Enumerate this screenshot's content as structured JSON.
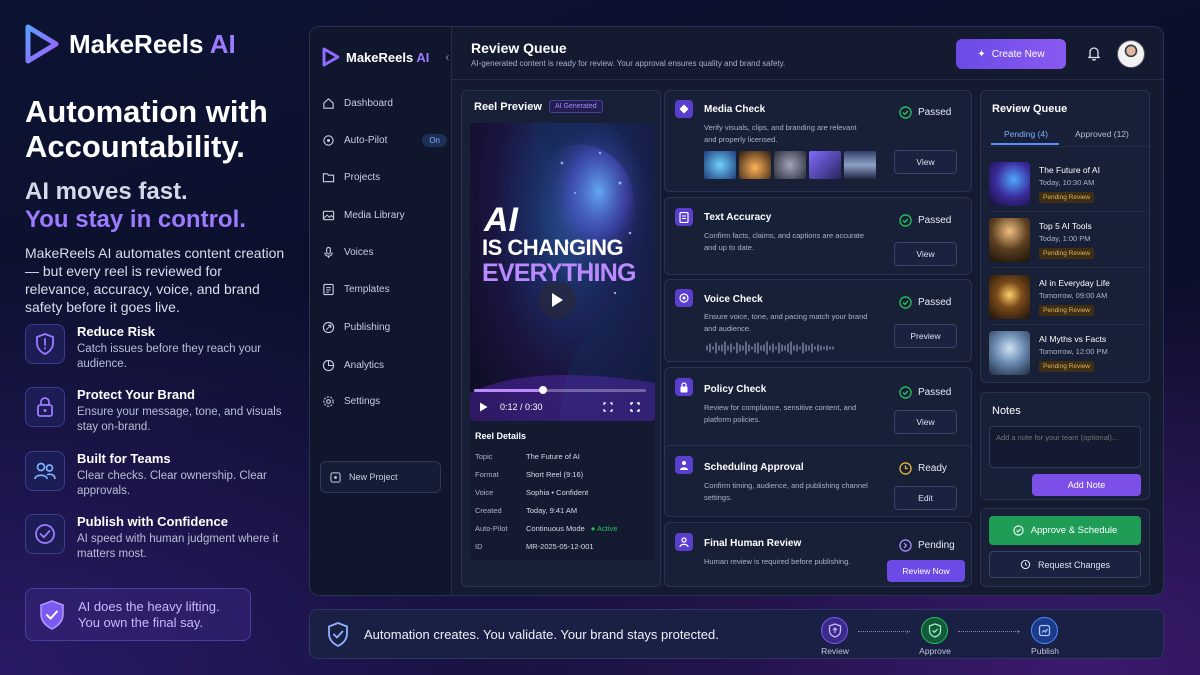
{
  "brand": {
    "name": "MakeReels",
    "suffix": "AI"
  },
  "hero": {
    "headline": "Automation with Accountability.",
    "tagline_1": "AI moves fast.",
    "tagline_2": "You stay in control.",
    "body": "MakeReels AI automates content creation — but every reel is reviewed for relevance, accuracy, voice, and brand safety before it goes live."
  },
  "features": [
    {
      "title": "Reduce Risk",
      "desc": "Catch issues before they reach your audience.",
      "icon": "shield-icon"
    },
    {
      "title": "Protect Your Brand",
      "desc": "Ensure your message, tone, and visuals stay on-brand.",
      "icon": "lock-icon"
    },
    {
      "title": "Built for Teams",
      "desc": "Clear checks. Clear ownership. Clear approvals.",
      "icon": "users-icon"
    },
    {
      "title": "Publish with Confidence",
      "desc": "AI speed with human judgment where it matters most.",
      "icon": "check-circle-icon"
    }
  ],
  "callout": {
    "line1": "AI does the heavy lifting.",
    "line2": "You own the final say."
  },
  "app": {
    "brand": {
      "name": "MakeReels",
      "suffix": "AI"
    },
    "nav": [
      {
        "label": "Dashboard",
        "icon": "home-icon"
      },
      {
        "label": "Auto-Pilot",
        "icon": "autopilot-icon",
        "badge": "On"
      },
      {
        "label": "Projects",
        "icon": "folder-icon"
      },
      {
        "label": "Media Library",
        "icon": "image-icon"
      },
      {
        "label": "Voices",
        "icon": "microphone-icon"
      },
      {
        "label": "Templates",
        "icon": "template-icon"
      },
      {
        "label": "Publishing",
        "icon": "send-icon"
      },
      {
        "label": "Analytics",
        "icon": "chart-icon"
      },
      {
        "label": "Settings",
        "icon": "gear-icon"
      }
    ],
    "new_project": "New Project",
    "header": {
      "title": "Review Queue",
      "subtitle": "AI-generated content is ready for review. Your approval ensures quality and brand safety.",
      "create_label": "Create New"
    },
    "reel": {
      "title": "Reel Preview",
      "tag": "AI Generated",
      "overlay_1": "AI",
      "overlay_2": "IS CHANGING",
      "overlay_3": "EVERYTHING",
      "time": "0:12 / 0:30",
      "progress": 0.4,
      "details_title": "Reel Details",
      "details": [
        {
          "k": "Topic",
          "v": "The Future of AI"
        },
        {
          "k": "Format",
          "v": "Short Reel (9:16)"
        },
        {
          "k": "Voice",
          "v": "Sophia • Confident"
        },
        {
          "k": "Created",
          "v": "Today, 9:41 AM"
        },
        {
          "k": "Auto-Pilot",
          "v": "Continuous Mode",
          "extra": "Active"
        },
        {
          "k": "ID",
          "v": "MR-2025-05-12-001"
        }
      ]
    },
    "checks": [
      {
        "title": "Media Check",
        "desc": "Verify visuals, clips, and branding are relevant and properly licensed.",
        "status": "Passed",
        "action": "View"
      },
      {
        "title": "Text Accuracy",
        "desc": "Confirm facts, claims, and captions are accurate and up to date.",
        "status": "Passed",
        "action": "View"
      },
      {
        "title": "Voice Check",
        "desc": "Ensure voice, tone, and pacing match your brand and audience.",
        "status": "Passed",
        "action": "Preview"
      },
      {
        "title": "Policy Check",
        "desc": "Review for compliance, sensitive content, and platform policies.",
        "status": "Passed",
        "action": "View"
      },
      {
        "title": "Scheduling Approval",
        "desc": "Confirm timing, audience, and publishing channel settings.",
        "status": "Ready",
        "action": "Edit"
      },
      {
        "title": "Final Human Review",
        "desc": "Human review is required before publishing.",
        "status": "Pending",
        "action": "Review Now"
      }
    ],
    "queue": {
      "title": "Review Queue",
      "tab_pending": "Pending (4)",
      "tab_approved": "Approved (12)",
      "items": [
        {
          "title": "The Future of AI",
          "time": "Today, 10:30 AM",
          "badge": "Pending Review"
        },
        {
          "title": "Top 5 AI Tools",
          "time": "Today, 1:00 PM",
          "badge": "Pending Review"
        },
        {
          "title": "AI in Everyday Life",
          "time": "Tomorrow, 09:00 AM",
          "badge": "Pending Review"
        },
        {
          "title": "AI Myths vs Facts",
          "time": "Tomorrow, 12:00 PM",
          "badge": "Pending Review"
        }
      ]
    },
    "notes": {
      "title": "Notes",
      "placeholder": "Add a note for your team (optional)...",
      "button": "Add Note"
    },
    "approve": "Approve & Schedule",
    "request": "Request Changes"
  },
  "bottom": {
    "text": "Automation creates. You validate. Your brand stays protected.",
    "steps": [
      "Review",
      "Approve",
      "Publish"
    ]
  },
  "colors": {
    "accent": "#8a5af0",
    "success": "#22c55e",
    "warning": "#e5b33a",
    "approve": "#1f9d57"
  }
}
